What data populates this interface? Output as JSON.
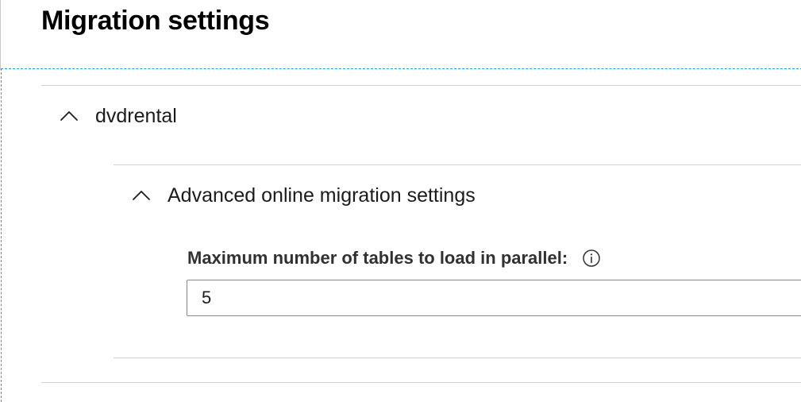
{
  "page": {
    "title": "Migration settings"
  },
  "database": {
    "name": "dvdrental",
    "expanded": true
  },
  "advanced": {
    "title": "Advanced online migration settings",
    "expanded": true,
    "max_tables": {
      "label": "Maximum number of tables to load in parallel:",
      "value": "5"
    }
  },
  "colors": {
    "focus_outline": "#1aa6d6",
    "divider": "#d2d2d2",
    "input_border": "#8a8886"
  },
  "icons": {
    "collapse": "chevron-up-icon",
    "info": "info-icon"
  }
}
